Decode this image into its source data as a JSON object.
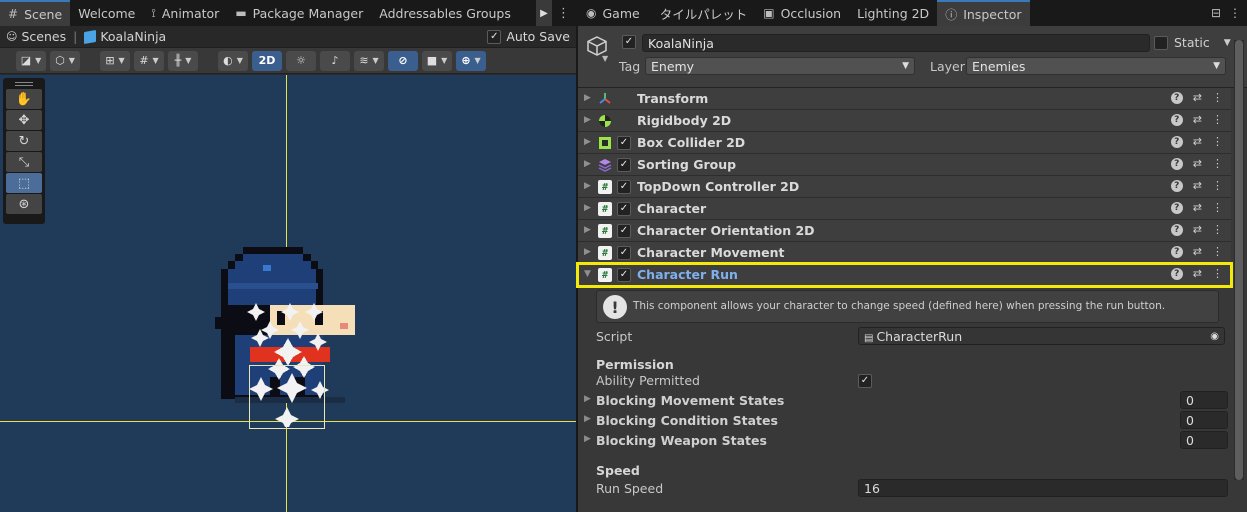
{
  "scene_panel": {
    "tabs": [
      {
        "label": "Scene",
        "icon": "grid-icon",
        "active": true
      },
      {
        "label": "Welcome",
        "icon": "",
        "active": false
      },
      {
        "label": "Animator",
        "icon": "animator-icon",
        "active": false
      },
      {
        "label": "Package Manager",
        "icon": "package-icon",
        "active": false
      },
      {
        "label": "Addressables Groups",
        "icon": "",
        "active": false
      }
    ],
    "breadcrumb": {
      "root": "Scenes",
      "current": "KoalaNinja"
    },
    "auto_save": {
      "label": "Auto Save",
      "checked": true
    },
    "toolbar": {
      "mode_2d_label": "2D"
    },
    "tool_palette": [
      "hand-tool",
      "move-tool",
      "rotate-tool",
      "scale-tool",
      "rect-tool",
      "transform-tool"
    ],
    "selected_tool": "rect-tool"
  },
  "inspector": {
    "tabs": [
      {
        "label": "Game",
        "icon": "game-icon",
        "active": false
      },
      {
        "label": "タイルパレット",
        "icon": "",
        "active": false
      },
      {
        "label": "Occlusion",
        "icon": "occlusion-icon",
        "active": false
      },
      {
        "label": "Lighting 2D",
        "icon": "",
        "active": false
      },
      {
        "label": "Inspector",
        "icon": "info-icon",
        "active": true
      }
    ],
    "game_object": {
      "active": true,
      "name": "KoalaNinja",
      "static_label": "Static",
      "static_checked": false,
      "tag_label": "Tag",
      "tag_value": "Enemy",
      "layer_label": "Layer",
      "layer_value": "Enemies"
    },
    "components": [
      {
        "label": "Transform",
        "icon": "transform-icon",
        "has_checkbox": false,
        "checked": false
      },
      {
        "label": "Rigidbody 2D",
        "icon": "rigidbody-icon",
        "has_checkbox": false,
        "checked": false
      },
      {
        "label": "Box Collider 2D",
        "icon": "box-collider-icon",
        "has_checkbox": true,
        "checked": true
      },
      {
        "label": "Sorting Group",
        "icon": "sorting-group-icon",
        "has_checkbox": true,
        "checked": true
      },
      {
        "label": "TopDown Controller 2D",
        "icon": "script-icon",
        "has_checkbox": true,
        "checked": true
      },
      {
        "label": "Character",
        "icon": "script-icon",
        "has_checkbox": true,
        "checked": true
      },
      {
        "label": "Character Orientation 2D",
        "icon": "script-icon",
        "has_checkbox": true,
        "checked": true
      },
      {
        "label": "Character Movement",
        "icon": "script-icon",
        "has_checkbox": true,
        "checked": true
      },
      {
        "label": "Character Run",
        "icon": "script-icon",
        "has_checkbox": true,
        "checked": true,
        "expanded": true,
        "highlighted": true
      }
    ],
    "character_run": {
      "help_text": "This component allows your character to change speed (defined here) when pressing the run button.",
      "script_label": "Script",
      "script_value": "CharacterRun",
      "permission_header": "Permission",
      "ability_permitted_label": "Ability Permitted",
      "ability_permitted": true,
      "blocking_movement_label": "Blocking Movement States",
      "blocking_movement_value": "0",
      "blocking_condition_label": "Blocking Condition States",
      "blocking_condition_value": "0",
      "blocking_weapon_label": "Blocking Weapon States",
      "blocking_weapon_value": "0",
      "speed_header": "Speed",
      "run_speed_label": "Run Speed",
      "run_speed_value": "16"
    }
  },
  "colors": {
    "scene_background": "#203a5a",
    "axis_lines": "#e8e14a",
    "highlight_outline": "#f3e90a",
    "selected_component_text": "#7fb0ee"
  }
}
